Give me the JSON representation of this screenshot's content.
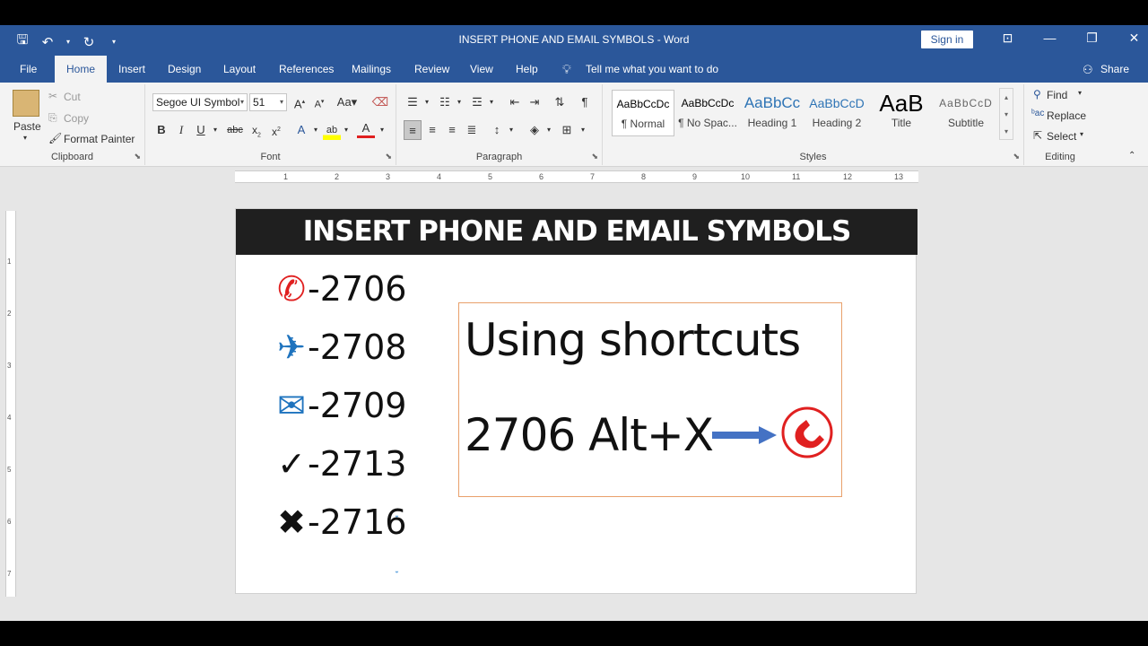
{
  "window": {
    "title": "INSERT PHONE AND EMAIL SYMBOLS  -  Word",
    "sign_in": "Sign in"
  },
  "tabs": [
    "File",
    "Home",
    "Insert",
    "Design",
    "Layout",
    "References",
    "Mailings",
    "Review",
    "View",
    "Help"
  ],
  "tell_me": "Tell me what you want to do",
  "share": "Share",
  "clipboard": {
    "paste": "Paste",
    "cut": "Cut",
    "copy": "Copy",
    "format_painter": "Format Painter",
    "label": "Clipboard"
  },
  "font": {
    "name": "Segoe UI Symbol",
    "size": "51",
    "label": "Font"
  },
  "paragraph": {
    "label": "Paragraph"
  },
  "styles": {
    "label": "Styles",
    "items": [
      {
        "preview": "AaBbCcDc",
        "name": "¶ Normal"
      },
      {
        "preview": "AaBbCcDc",
        "name": "¶ No Spac..."
      },
      {
        "preview": "AaBbCc",
        "name": "Heading 1"
      },
      {
        "preview": "AaBbCcD",
        "name": "Heading 2"
      },
      {
        "preview": "AaB",
        "name": "Title"
      },
      {
        "preview": "AaBbCcD",
        "name": "Subtitle"
      }
    ]
  },
  "editing": {
    "find": "Find",
    "replace": "Replace",
    "select": "Select",
    "label": "Editing"
  },
  "ruler": [
    "1",
    "2",
    "3",
    "4",
    "5",
    "6",
    "7",
    "8",
    "9",
    "10",
    "11",
    "12",
    "13"
  ],
  "vruler": [
    "1",
    "2",
    "3",
    "4",
    "5",
    "6",
    "7"
  ],
  "document": {
    "banner": "INSERT PHONE AND EMAIL SYMBOLS",
    "symbols": [
      {
        "icon": "✆",
        "icon_name": "phone-circle-icon",
        "color": "#e02020",
        "code": "-2706"
      },
      {
        "icon": "✈",
        "icon_name": "airplane-icon",
        "color": "#1e73be",
        "code": "-2708"
      },
      {
        "icon": "✉",
        "icon_name": "envelope-icon",
        "color": "#1e73be",
        "code": "-2709"
      },
      {
        "icon": "✓",
        "icon_name": "check-mark-icon",
        "color": "#111111",
        "code": "-2713"
      },
      {
        "icon": "✖",
        "icon_name": "heavy-x-icon",
        "color": "#111111",
        "code": "-2716"
      }
    ],
    "shortcut_title": "Using shortcuts",
    "shortcut_text": "2706 Alt+X",
    "box_border_color": "#e9a06b",
    "arrow_color": "#4472c4",
    "phone_color": "#e02020"
  }
}
